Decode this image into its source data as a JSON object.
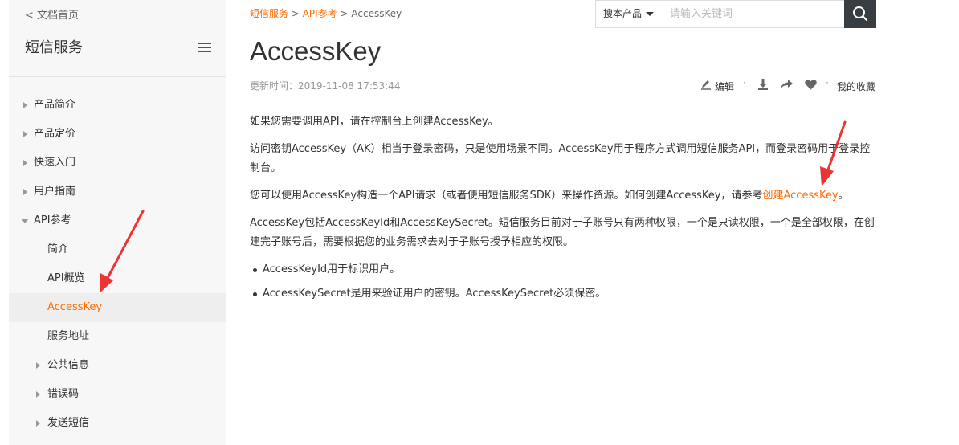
{
  "sidebar": {
    "back_label": "< 文档首页",
    "title": "短信服务",
    "items": [
      {
        "label": "产品简介"
      },
      {
        "label": "产品定价"
      },
      {
        "label": "快速入门"
      },
      {
        "label": "用户指南"
      },
      {
        "label": "API参考"
      },
      {
        "label": "简介"
      },
      {
        "label": "API概览"
      },
      {
        "label": "AccessKey"
      },
      {
        "label": "服务地址"
      },
      {
        "label": "公共信息"
      },
      {
        "label": "错误码"
      },
      {
        "label": "发送短信"
      }
    ]
  },
  "breadcrumb": {
    "item1": "短信服务",
    "sep": " > ",
    "item2": "API参考",
    "current": "AccessKey"
  },
  "search": {
    "scope_label": "搜本产品",
    "placeholder": "请输入关键词"
  },
  "page": {
    "title": "AccessKey",
    "updated": "更新时间：2019-11-08 17:53:44"
  },
  "toolbar": {
    "edit_label": "编辑",
    "favorites_label": "我的收藏",
    "separator": "·"
  },
  "content": {
    "p1": "如果您需要调用API，请在控制台上创建AccessKey。",
    "p2": "访问密钥AccessKey（AK）相当于登录密码，只是使用场景不同。AccessKey用于程序方式调用短信服务API，而登录密码用于登录控制台。",
    "p3_prefix": "您可以使用AccessKey构造一个API请求（或者使用短信服务SDK）来操作资源。如何创建AccessKey，请参考",
    "p3_link": "创建AccessKey",
    "p3_suffix": "。",
    "p4": "AccessKey包括AccessKeyId和AccessKeySecret。短信服务目前对于子账号只有两种权限，一个是只读权限，一个是全部权限，在创建完子账号后，需要根据您的业务需求去对于子账号授予相应的权限。",
    "bullets": [
      "AccessKeyId用于标识用户。",
      "AccessKeySecret是用来验证用户的密钥。AccessKeySecret必须保密。"
    ]
  },
  "colors": {
    "accent": "#ff6a00",
    "sidebar_bg": "#f7f7f7",
    "active_bg": "#eeeeee",
    "search_btn": "#373d41",
    "annotation": "#ee3333"
  }
}
